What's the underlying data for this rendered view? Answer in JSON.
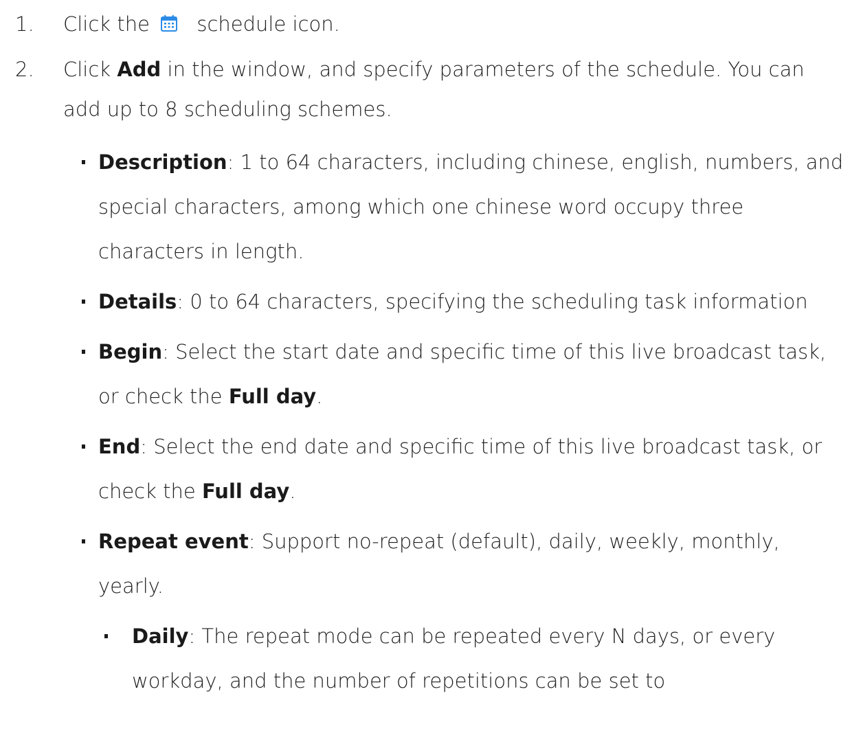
{
  "steps": [
    {
      "number": "1.",
      "text_before_icon": "Click the",
      "icon": "calendar-icon",
      "text_after_icon": "schedule icon."
    },
    {
      "number": "2.",
      "text_before": "Click ",
      "bold": "Add",
      "text_after": " in the window, and specify parameters of the schedule. You can add up to 8 scheduling schemes."
    }
  ],
  "bullets": [
    {
      "term": "Description",
      "text": ": 1 to 64 characters, including chinese, english, numbers, and special characters, among which one chinese word occupy three characters in length."
    },
    {
      "term": "Details",
      "text": ": 0 to 64 characters, specifying the scheduling task information"
    },
    {
      "term": "Begin",
      "text": ": Select the start date and specific time of this live broadcast task, or check the ",
      "bold_tail": "Full day",
      "end": "."
    },
    {
      "term": "End",
      "text": ": Select the end date and specific time of this live broadcast task, or check the ",
      "bold_tail": "Full day",
      "end": "."
    },
    {
      "term": "Repeat event",
      "text": ": Support no-repeat (default), daily, weekly, monthly, yearly."
    }
  ],
  "sub_bullets": [
    {
      "term": "Daily",
      "text": ": The repeat mode can be repeated every N days, or every workday, and the number of repetitions can be set to"
    }
  ],
  "colors": {
    "icon_blue": "#2b8be6",
    "text": "#1f1f1f"
  }
}
